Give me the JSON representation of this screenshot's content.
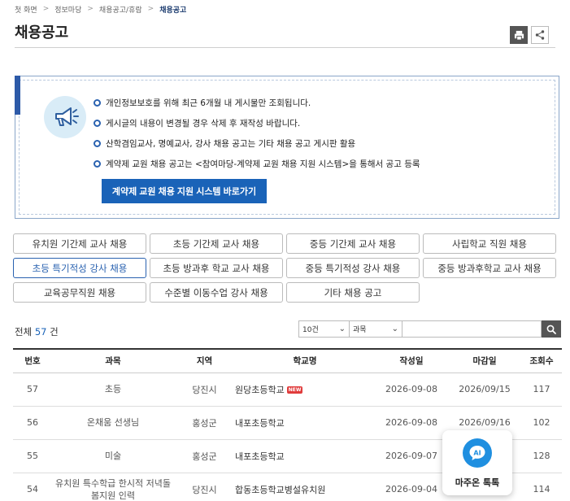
{
  "breadcrumb": {
    "home": "첫 화면",
    "level1": "정보마당",
    "level2": "채용공고/휴람",
    "current": "채용공고"
  },
  "page_title": "채용공고",
  "notice": {
    "items": [
      "개인정보보호를 위해 최근 6개월 내 게시물만 조회됩니다.",
      "게시글의 내용이 변경될 경우 삭제 후 재작성 바랍니다.",
      "산학겸임교사, 명예교사, 강사 채용 공고는 기타 채용 공고 게시판 활용",
      "계약제 교원 채용 공고는 <참여마당-계약제 교원 채용 지원 시스템>을 통해서 공고 등록"
    ],
    "button_label": "계약제 교원 채용 지원 시스템 바로가기"
  },
  "categories": [
    "유치원 기간제 교사 채용",
    "초등 기간제 교사 채용",
    "중등 기간제 교사 채용",
    "사립학교 직원 채용",
    "초등 특기적성 강사 채용",
    "초등 방과후 학교 교사 채용",
    "중등 특기적성 강사 채용",
    "중등 방과후학교 교사 채용",
    "교육공무직원 채용",
    "수준별 이동수업 강사 채용",
    "기타 채용 공고"
  ],
  "total": {
    "prefix": "전체",
    "count": "57",
    "suffix": "건"
  },
  "search": {
    "count_option": "10건",
    "subject_option": "과목"
  },
  "table": {
    "headers": [
      "번호",
      "과목",
      "지역",
      "학교명",
      "작성일",
      "마감일",
      "조회수"
    ],
    "rows": [
      {
        "no": "57",
        "subject": "초등",
        "region": "당진시",
        "school": "원당초등학교",
        "new": "NEW",
        "written": "2026-09-08",
        "deadline": "2026/09/15",
        "views": "117"
      },
      {
        "no": "56",
        "subject": "온채움 선생님",
        "region": "홍성군",
        "school": "내포초등학교",
        "new": "",
        "written": "2026-09-08",
        "deadline": "2026/09/16",
        "views": "102"
      },
      {
        "no": "55",
        "subject": "미술",
        "region": "홍성군",
        "school": "내포초등학교",
        "new": "",
        "written": "2026-09-07",
        "deadline": "",
        "views": "128"
      },
      {
        "no": "54",
        "subject": "유치원 특수학급 한시적 저녁돌봄지원 인력",
        "region": "당진시",
        "school": "합동초등학교병설유치원",
        "new": "",
        "written": "2026-09-04",
        "deadline": "",
        "views": "114"
      }
    ]
  },
  "chat": {
    "label": "마주온 톡톡"
  }
}
